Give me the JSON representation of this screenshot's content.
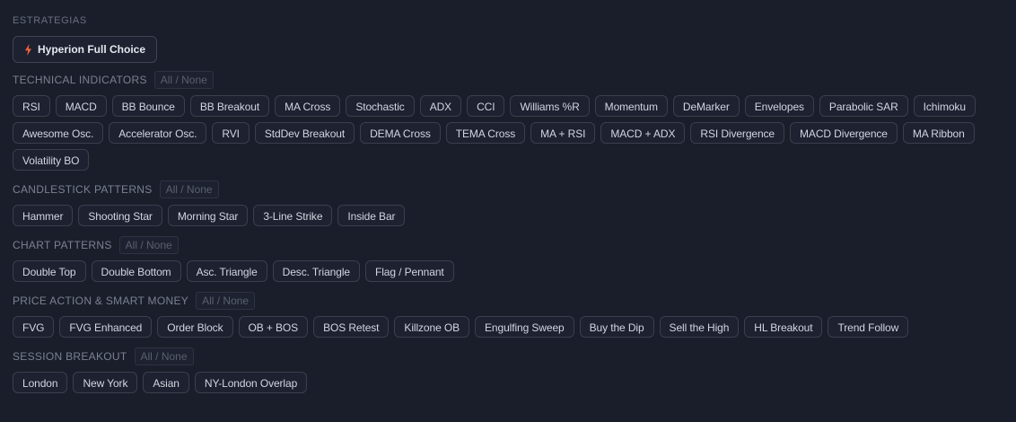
{
  "strategies": {
    "title": "ESTRATEGIAS",
    "button_label": "Hyperion Full Choice",
    "button_icon": "lightning-bolt-icon",
    "accent": "#f0623f"
  },
  "all_none_label": "All / None",
  "sections": [
    {
      "id": "technical-indicators",
      "title": "TECHNICAL INDICATORS",
      "items": [
        "RSI",
        "MACD",
        "BB Bounce",
        "BB Breakout",
        "MA Cross",
        "Stochastic",
        "ADX",
        "CCI",
        "Williams %R",
        "Momentum",
        "DeMarker",
        "Envelopes",
        "Parabolic SAR",
        "Ichimoku",
        "Awesome Osc.",
        "Accelerator Osc.",
        "RVI",
        "StdDev Breakout",
        "DEMA Cross",
        "TEMA Cross",
        "MA + RSI",
        "MACD + ADX",
        "RSI Divergence",
        "MACD Divergence",
        "MA Ribbon",
        "Volatility BO"
      ]
    },
    {
      "id": "candlestick-patterns",
      "title": "CANDLESTICK PATTERNS",
      "items": [
        "Hammer",
        "Shooting Star",
        "Morning Star",
        "3-Line Strike",
        "Inside Bar"
      ]
    },
    {
      "id": "chart-patterns",
      "title": "CHART PATTERNS",
      "items": [
        "Double Top",
        "Double Bottom",
        "Asc. Triangle",
        "Desc. Triangle",
        "Flag / Pennant"
      ]
    },
    {
      "id": "price-action-smart-money",
      "title": "PRICE ACTION & SMART MONEY",
      "items": [
        "FVG",
        "FVG Enhanced",
        "Order Block",
        "OB + BOS",
        "BOS Retest",
        "Killzone OB",
        "Engulfing Sweep",
        "Buy the Dip",
        "Sell the High",
        "HL Breakout",
        "Trend Follow"
      ]
    },
    {
      "id": "session-breakout",
      "title": "SESSION BREAKOUT",
      "items": [
        "London",
        "New York",
        "Asian",
        "NY-London Overlap"
      ]
    }
  ]
}
